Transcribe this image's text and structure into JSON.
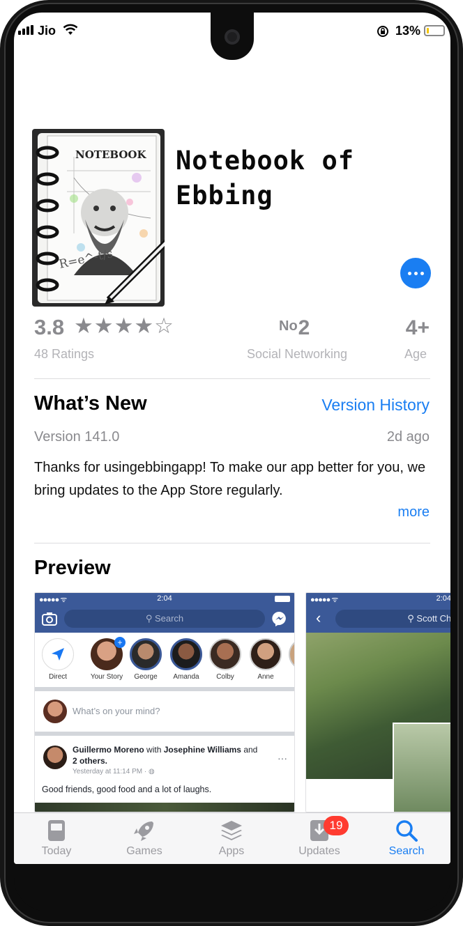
{
  "status_bar": {
    "carrier": "Jio",
    "battery_percent": "13%",
    "battery_level": 0.13
  },
  "app": {
    "title": "Notebook of Ebbing",
    "icon_label": "NOTEBOOK",
    "icon_formula": "R=e^-t/s"
  },
  "ratings": {
    "value": "3.8",
    "stars": "★★★★☆",
    "stars_value": 3.8,
    "count_label": "48 Ratings",
    "rank_prefix": "No",
    "rank_number": "2",
    "rank_category": "Social Networking",
    "age_rating": "4+",
    "age_label": "Age"
  },
  "whats_new": {
    "title": "What’s New",
    "version_history_link": "Version History",
    "version": "Version 141.0",
    "date": "2d ago",
    "notes": "Thanks for usingebbingapp! To make our app better for you, we bring updates to the App Store regularly.",
    "more_link": "more"
  },
  "preview": {
    "title": "Preview",
    "screenshot1": {
      "time": "2:04",
      "search_placeholder": "Search",
      "stories": [
        "Direct",
        "Your Story",
        "George",
        "Amanda",
        "Colby",
        "Anne"
      ],
      "composer_placeholder": "What’s on your mind?",
      "post_author": "Guillermo Moreno",
      "post_with": "with",
      "post_tagged": "Josephine Williams",
      "post_and": "and",
      "post_others": "2 others.",
      "post_time": "Yesterday at 11:14 PM · ",
      "post_body": "Good friends, good food and a lot of laughs."
    },
    "screenshot2": {
      "time": "2:04",
      "search_text": "Scott Chris"
    }
  },
  "tab_bar": {
    "tabs": [
      {
        "label": "Today",
        "icon": "today-icon"
      },
      {
        "label": "Games",
        "icon": "rocket-icon"
      },
      {
        "label": "Apps",
        "icon": "stack-icon"
      },
      {
        "label": "Updates",
        "icon": "download-icon"
      },
      {
        "label": "Search",
        "icon": "search-icon"
      }
    ],
    "updates_badge": "19",
    "active_tab": "Search"
  },
  "colors": {
    "accent": "#1a7ef2",
    "badge": "#ff3b30",
    "facebook_blue": "#3b5998",
    "secondary_text": "#8a8a8e"
  }
}
